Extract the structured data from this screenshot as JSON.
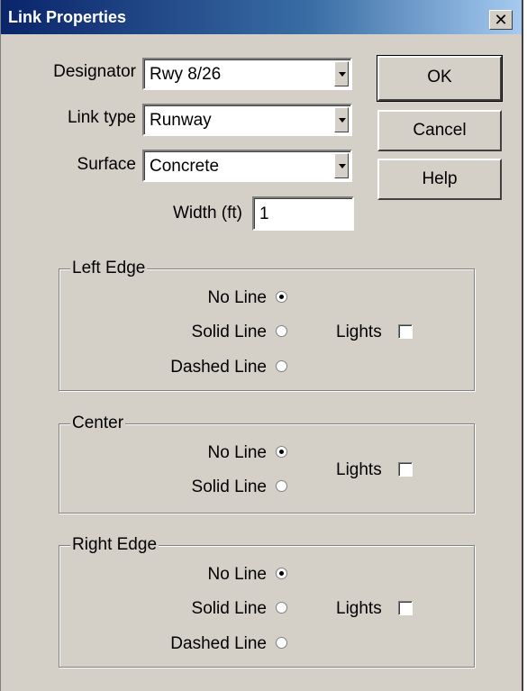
{
  "window": {
    "title": "Link Properties",
    "close_glyph": "✕"
  },
  "fields": {
    "designator_label": "Designator",
    "designator_value": "Rwy 8/26",
    "link_type_label": "Link type",
    "link_type_value": "Runway",
    "surface_label": "Surface",
    "surface_value": "Concrete",
    "width_label": "Width (ft)",
    "width_value": "1"
  },
  "buttons": {
    "ok": "OK",
    "cancel": "Cancel",
    "help": "Help"
  },
  "left_edge": {
    "title": "Left Edge",
    "no_line": "No Line",
    "solid_line": "Solid Line",
    "dashed_line": "Dashed Line",
    "lights": "Lights",
    "selected": "no_line",
    "lights_checked": false
  },
  "center": {
    "title": "Center",
    "no_line": "No Line",
    "solid_line": "Solid Line",
    "lights": "Lights",
    "selected": "no_line",
    "lights_checked": false
  },
  "right_edge": {
    "title": "Right Edge",
    "no_line": "No Line",
    "solid_line": "Solid Line",
    "dashed_line": "Dashed Line",
    "lights": "Lights",
    "selected": "no_line",
    "lights_checked": false
  }
}
